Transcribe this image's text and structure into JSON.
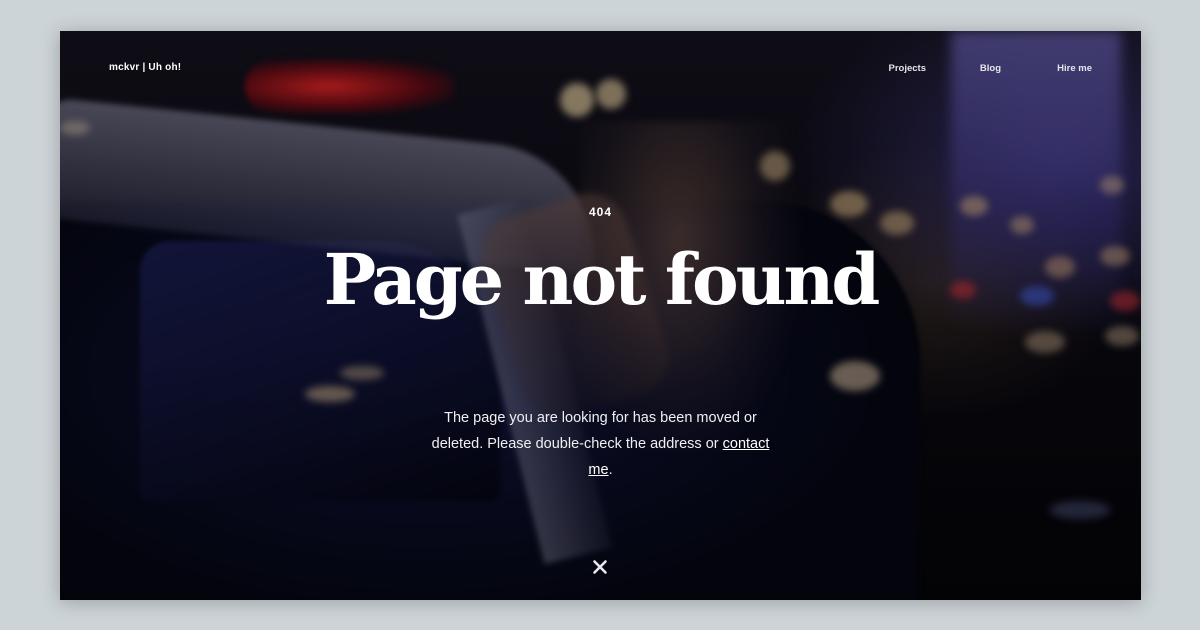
{
  "header": {
    "brand": "mckvr | Uh oh!",
    "nav": [
      {
        "label": "Projects"
      },
      {
        "label": "Blog"
      },
      {
        "label": "Hire me"
      }
    ]
  },
  "error": {
    "code": "404",
    "title": "Page not found",
    "message_before": "The page you are looking for has been moved or deleted. Please double-check the address or ",
    "link_label": "contact me",
    "message_after": "."
  },
  "icons": {
    "close": "close-icon"
  },
  "colors": {
    "page_background": "#cdd4d8",
    "text": "#ffffff"
  }
}
